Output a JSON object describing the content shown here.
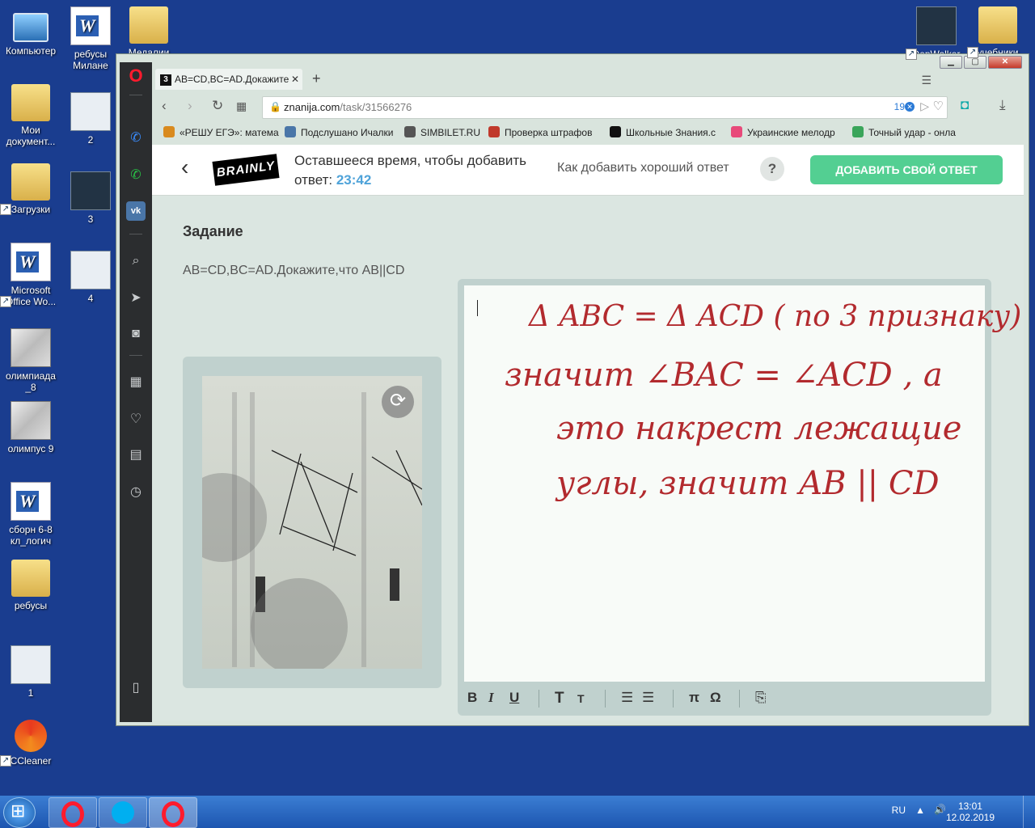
{
  "desktop": {
    "icons": [
      {
        "label": "Компьютер"
      },
      {
        "label": "ребусы Милане"
      },
      {
        "label": "Медалии"
      },
      {
        "label": "Мои документ..."
      },
      {
        "label": "2"
      },
      {
        "label": "Загрузки"
      },
      {
        "label": "3"
      },
      {
        "label": "Microsoft Office Wo..."
      },
      {
        "label": "4"
      },
      {
        "label": "олимпиада _8"
      },
      {
        "label": "олимпус 9"
      },
      {
        "label": "сборн 6-8 кл_логич"
      },
      {
        "label": "ребусы"
      },
      {
        "label": "1"
      },
      {
        "label": "CCleaner"
      },
      {
        "label": "DepWalker"
      },
      {
        "label": "учебники"
      }
    ]
  },
  "browser": {
    "tab_title": "AB=CD,BC=AD.Докажите",
    "tab_favicon": "3",
    "address": {
      "domain": "znanija.com",
      "path": "/task/31566276",
      "badge_count": "19"
    },
    "bookmarks": [
      {
        "label": "«РЕШУ ЕГЭ»: матема",
        "color": "#d98a1e"
      },
      {
        "label": "Подслушано Ичалки",
        "color": "#4a76a8"
      },
      {
        "label": "SIMBILET.RU",
        "color": "#555555"
      },
      {
        "label": "Проверка штрафов",
        "color": "#c0392b"
      },
      {
        "label": "Школьные Знания.с",
        "color": "#111111"
      },
      {
        "label": "Украинские мелодр",
        "color": "#e84a7a"
      },
      {
        "label": "Точный удар - онла",
        "color": "#3aa55a"
      }
    ]
  },
  "page": {
    "logo": "BRAINLY",
    "timer_text": "Оставшееся время, чтобы добавить",
    "timer_prefix": "ответ:",
    "timer_value": "23:42",
    "how_to": "Как добавить хороший ответ",
    "help_mark": "?",
    "add_button": "ДОБАВИТЬ СВОЙ ОТВЕТ",
    "task_title": "Задание",
    "task_text": "AB=CD,BC=AD.Докажите,что AB||CD",
    "answer_lines": [
      "Δ ABC = Δ ACD ( по 3 признаку)",
      "значит   ∠BAC = ∠ACD , а",
      "это   накрест   лежащие",
      "углы,  значит   AB || CD"
    ],
    "toolbar": {
      "bold": "B",
      "italic": "I",
      "underline": "U",
      "heading_big": "T",
      "heading_small": "T",
      "pi": "π",
      "omega": "Ω"
    }
  },
  "taskbar": {
    "lang": "RU",
    "time": "13:01",
    "date": "12.02.2019"
  },
  "colors": {
    "desktop_bg": "#1a3d8f",
    "accent_green": "#53cf92",
    "timer_blue": "#4fa3d9",
    "handwriting": "#b22a2e"
  }
}
